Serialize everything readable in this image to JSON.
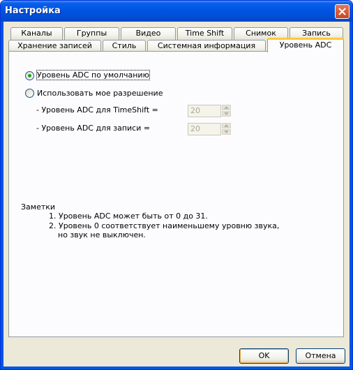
{
  "window": {
    "title": "Настройка"
  },
  "tabs_row1": [
    "Каналы",
    "Группы",
    "Видео",
    "Time Shift",
    "Снимок",
    "Запись"
  ],
  "tabs_row2": [
    "Хранение записей",
    "Стиль",
    "Системная информация",
    "Уровень ADC"
  ],
  "active_tab": "Уровень ADC",
  "options": {
    "default_label": "Уровень ADC по умолчанию",
    "custom_label": "Использовать мое разрешение",
    "selected": "default"
  },
  "fields": {
    "timeshift_label": "- Уровень ADC для TimeShift =",
    "timeshift_value": "20",
    "record_label": "- Уровень ADC для записи =",
    "record_value": "20"
  },
  "notes": {
    "title": "Заметки",
    "line1": "1. Уровень ADC может быть от 0 до 31.",
    "line2": "2. Уровень 0 соответствует наименьшему уровню звука,",
    "line3": "но звук не выключен."
  },
  "buttons": {
    "ok": "OK",
    "cancel": "Отмена"
  },
  "colors": {
    "titlebar": "#0055e5",
    "dialog_bg": "#ece9d8",
    "tab_highlight": "#ffc83c",
    "radio_dot": "#21a121"
  },
  "icons": {
    "close": "close-icon",
    "spin_up": "spin-up-icon",
    "spin_down": "spin-down-icon"
  }
}
